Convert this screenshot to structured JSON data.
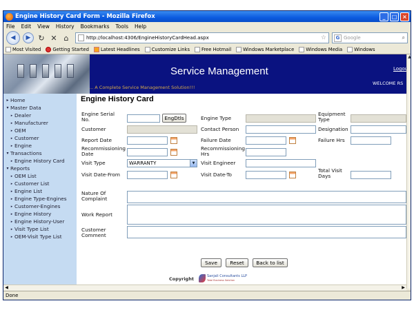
{
  "window": {
    "title": "Engine History Card Form - Mozilla Firefox"
  },
  "menu": [
    "File",
    "Edit",
    "View",
    "History",
    "Bookmarks",
    "Tools",
    "Help"
  ],
  "browser": {
    "url": "http://localhost:4306/EngineHistoryCardHead.aspx",
    "search_placeholder": "Google",
    "status": "Done"
  },
  "bookmarks": [
    "Most Visited",
    "Getting Started",
    "Latest Headlines",
    "Customize Links",
    "Free Hotmail",
    "Windows Marketplace",
    "Windows Media",
    "Windows"
  ],
  "header": {
    "title": "Service Management",
    "tagline": "... A Complete Service Management Solution!!!",
    "logout": "Logout",
    "welcome": "WELCOME RS"
  },
  "sidebar": {
    "items": [
      {
        "label": "Home",
        "level": 1,
        "mark": "▸"
      },
      {
        "label": "Master Data",
        "level": 1,
        "mark": "▾"
      },
      {
        "label": "Dealer",
        "level": 2,
        "mark": "▸"
      },
      {
        "label": "Manufacturer",
        "level": 2,
        "mark": "▸"
      },
      {
        "label": "OEM",
        "level": 2,
        "mark": "▸"
      },
      {
        "label": "Customer",
        "level": 2,
        "mark": "▸"
      },
      {
        "label": "Engine",
        "level": 2,
        "mark": "▸"
      },
      {
        "label": "Transactions",
        "level": 1,
        "mark": "▾"
      },
      {
        "label": "Engine History Card",
        "level": 2,
        "mark": "▸"
      },
      {
        "label": "Reports",
        "level": 1,
        "mark": "▾"
      },
      {
        "label": "OEM List",
        "level": 2,
        "mark": "▸"
      },
      {
        "label": "Customer List",
        "level": 2,
        "mark": "▸"
      },
      {
        "label": "Engine List",
        "level": 2,
        "mark": "▸"
      },
      {
        "label": "Engine Type-Engines",
        "level": 2,
        "mark": "▸"
      },
      {
        "label": "Customer-Engines",
        "level": 2,
        "mark": "▸"
      },
      {
        "label": "Engine History",
        "level": 2,
        "mark": "▸"
      },
      {
        "label": "Engine History-User",
        "level": 2,
        "mark": "▸"
      },
      {
        "label": "Visit Type List",
        "level": 2,
        "mark": "▸"
      },
      {
        "label": "OEM-Visit Type List",
        "level": 2,
        "mark": "▸"
      }
    ]
  },
  "form": {
    "title": "Engine History Card",
    "engine_serial_label": "Engine Serial No.",
    "eng_dtls_button": "EngDtls",
    "engine_type_label": "Engine Type",
    "equipment_type_label": "Equipment Type",
    "customer_label": "Customer",
    "contact_person_label": "Contact Person",
    "designation_label": "Designation",
    "report_date_label": "Report Date",
    "failure_date_label": "Failure Date",
    "failure_hrs_label": "Failure Hrs",
    "recommissioning_date_label": "Recommissioning Date",
    "recommissioning_hrs_label": "Recommissioning Hrs",
    "visit_type_label": "Visit Type",
    "visit_type_value": "WARRANTY",
    "visit_engineer_label": "Visit Engineer",
    "visit_date_from_label": "Visit Date-From",
    "visit_date_to_label": "Visit Date-To",
    "total_visit_days_label": "Total Visit Days",
    "nature_of_complaint_label": "Nature Of Complaint",
    "work_report_label": "Work Report",
    "customer_comment_label": "Customer Comment",
    "save_button": "Save",
    "reset_button": "Reset",
    "back_button": "Back to list",
    "copyright": "Copyright",
    "logo_name": "Sanjali Consultants LLP",
    "logo_tagline": "Total Business Solution"
  }
}
